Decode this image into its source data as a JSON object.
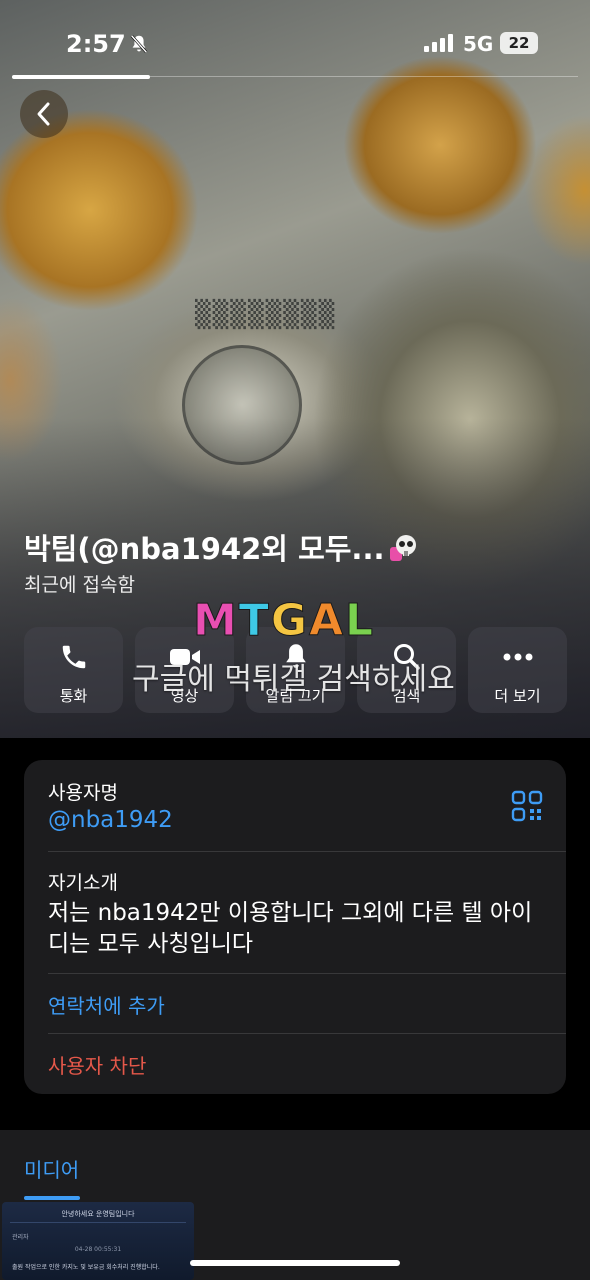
{
  "status_bar": {
    "time": "2:57",
    "network": "5G",
    "battery": "22"
  },
  "profile": {
    "name": "박팀(@nba1942외 모두...",
    "last_seen": "최근에 접속함"
  },
  "watermark": {
    "logo_letters": [
      "M",
      "T",
      "G",
      "A",
      "L"
    ],
    "logo_colors": [
      "#e94fb2",
      "#3ec9e6",
      "#f4c542",
      "#f08a2c",
      "#7ad14f"
    ],
    "text": "구글에 먹튀갤 검색하세요"
  },
  "actions": [
    {
      "label": "통화",
      "icon": "phone-icon"
    },
    {
      "label": "영상",
      "icon": "video-icon"
    },
    {
      "label": "알림 끄기",
      "icon": "bell-icon"
    },
    {
      "label": "검색",
      "icon": "search-icon"
    },
    {
      "label": "더 보기",
      "icon": "more-icon"
    }
  ],
  "info": {
    "username_label": "사용자명",
    "username": "@nba1942",
    "bio_label": "자기소개",
    "bio": "저는 nba1942만 이용합니다 그외에 다른 텔 아이디는 모두 사칭입니다",
    "add_contact": "연락처에 추가",
    "block_user": "사용자 차단"
  },
  "media": {
    "tab_label": "미디어",
    "thumb": {
      "title": "안녕하세요 운영팀입니다",
      "label": "관리자",
      "date": "04-28 00:55:31",
      "body": "출원 작업으로 인한 카지노 및 보유금 회수처리 진행합니다."
    }
  },
  "colors": {
    "accent": "#3e9cf5",
    "danger": "#e5584a",
    "card_bg": "#1c1c1e"
  }
}
